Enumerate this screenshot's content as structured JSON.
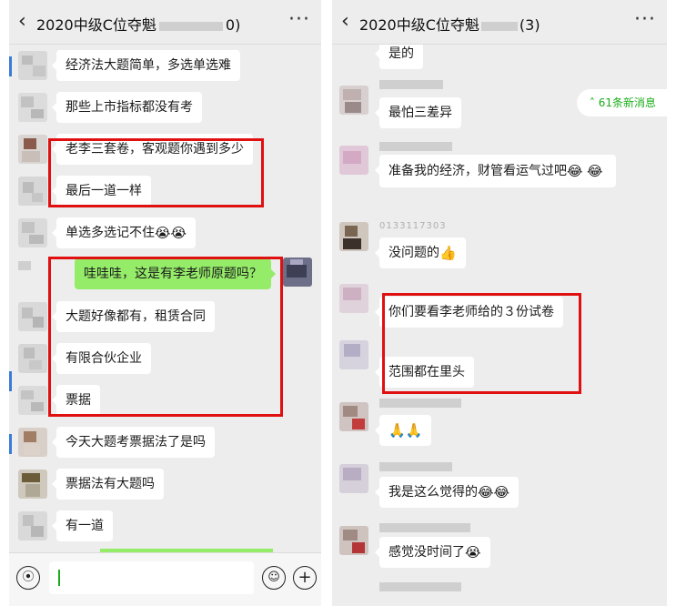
{
  "left": {
    "title": "2020中级C位夺魁",
    "title_tail": "0)",
    "back_icon": "chevron-left-icon",
    "more_label": "···",
    "messages": [
      {
        "text": "经济法大题简单，多选单选难"
      },
      {
        "text": "那些上市指标都没有考"
      },
      {
        "text": "老李三套卷，客观题你遇到多少"
      },
      {
        "text": "最后一道一样"
      },
      {
        "text": "单选多选记不住",
        "emoji": "😭😭"
      },
      {
        "text": "哇哇哇，这是有李老师原题吗？"
      },
      {
        "text": "大题好像都有，租赁合同"
      },
      {
        "text": "有限合伙企业"
      },
      {
        "text": "票据"
      },
      {
        "text": "今天大题考票据法了是吗"
      },
      {
        "text": "票据法有大题吗"
      },
      {
        "text": "有一道"
      }
    ],
    "input": {
      "voice_icon": "voice-icon",
      "emoji_icon": "emoji-icon",
      "plus_icon": "plus-icon"
    }
  },
  "right": {
    "title": "2020中级C位夺魁",
    "title_tail": "(",
    "title_end": "3)",
    "unread": {
      "icon": "double-chevron-up-icon",
      "text": "61条新消息"
    },
    "messages": [
      {
        "text": "是的"
      },
      {
        "text": "最怕三差异"
      },
      {
        "text": "准备我的经济，财管看运气过吧",
        "emoji": "😂",
        "emoji2": "😂"
      },
      {
        "text": "没问题的",
        "emoji": "👍"
      },
      {
        "text": "你们要看李老师给的３份试卷"
      },
      {
        "text": "范围都在里头"
      },
      {
        "text": "",
        "emoji": "🙏🙏"
      },
      {
        "text": "我是这么觉得的",
        "emoji": "😂😂"
      },
      {
        "text": "感觉没时间了",
        "emoji": "😭"
      }
    ],
    "nick_numbers": "0133117303"
  },
  "colors": {
    "accent_green": "#1aad19",
    "bubble_out": "#95ec69",
    "highlight_red": "#e01010",
    "chat_bg": "#ededed"
  }
}
